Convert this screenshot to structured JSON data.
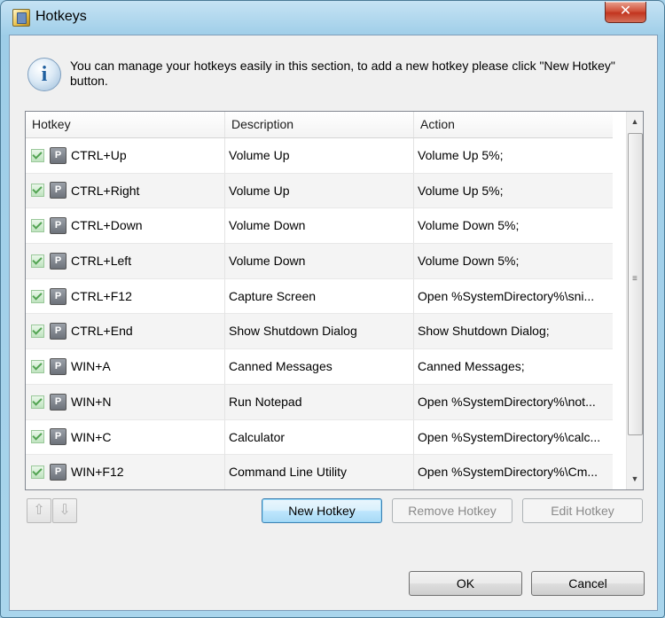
{
  "window": {
    "title": "Hotkeys",
    "close_label": "✕"
  },
  "info": {
    "text": "You can manage your hotkeys easily in this section, to add a new hotkey please click \"New Hotkey\" button.",
    "icon_glyph": "i"
  },
  "table": {
    "columns": [
      "Hotkey",
      "Description",
      "Action"
    ],
    "rows": [
      {
        "hotkey": "CTRL+Up",
        "description": "Volume Up",
        "action": "Volume Up 5%;"
      },
      {
        "hotkey": "CTRL+Right",
        "description": "Volume Up",
        "action": "Volume Up 5%;"
      },
      {
        "hotkey": "CTRL+Down",
        "description": "Volume Down",
        "action": "Volume Down 5%;"
      },
      {
        "hotkey": "CTRL+Left",
        "description": "Volume Down",
        "action": "Volume Down 5%;"
      },
      {
        "hotkey": "CTRL+F12",
        "description": "Capture Screen",
        "action": "Open %SystemDirectory%\\sni..."
      },
      {
        "hotkey": "CTRL+End",
        "description": "Show Shutdown Dialog",
        "action": "Show Shutdown Dialog;"
      },
      {
        "hotkey": "WIN+A",
        "description": "Canned Messages",
        "action": "Canned Messages;"
      },
      {
        "hotkey": "WIN+N",
        "description": "Run Notepad",
        "action": "Open %SystemDirectory%\\not..."
      },
      {
        "hotkey": "WIN+C",
        "description": "Calculator",
        "action": "Open %SystemDirectory%\\calc..."
      },
      {
        "hotkey": "WIN+F12",
        "description": "Command Line Utility",
        "action": "Open %SystemDirectory%\\Cm..."
      }
    ]
  },
  "buttons": {
    "new_hotkey": "New Hotkey",
    "remove_hotkey": "Remove Hotkey",
    "edit_hotkey": "Edit Hotkey",
    "ok": "OK",
    "cancel": "Cancel"
  },
  "icons": {
    "row_key_glyph": "P",
    "move_up": "⇧",
    "move_down": "⇩",
    "scroll_up": "▲",
    "scroll_down": "▼",
    "scroll_grip": "≡"
  }
}
